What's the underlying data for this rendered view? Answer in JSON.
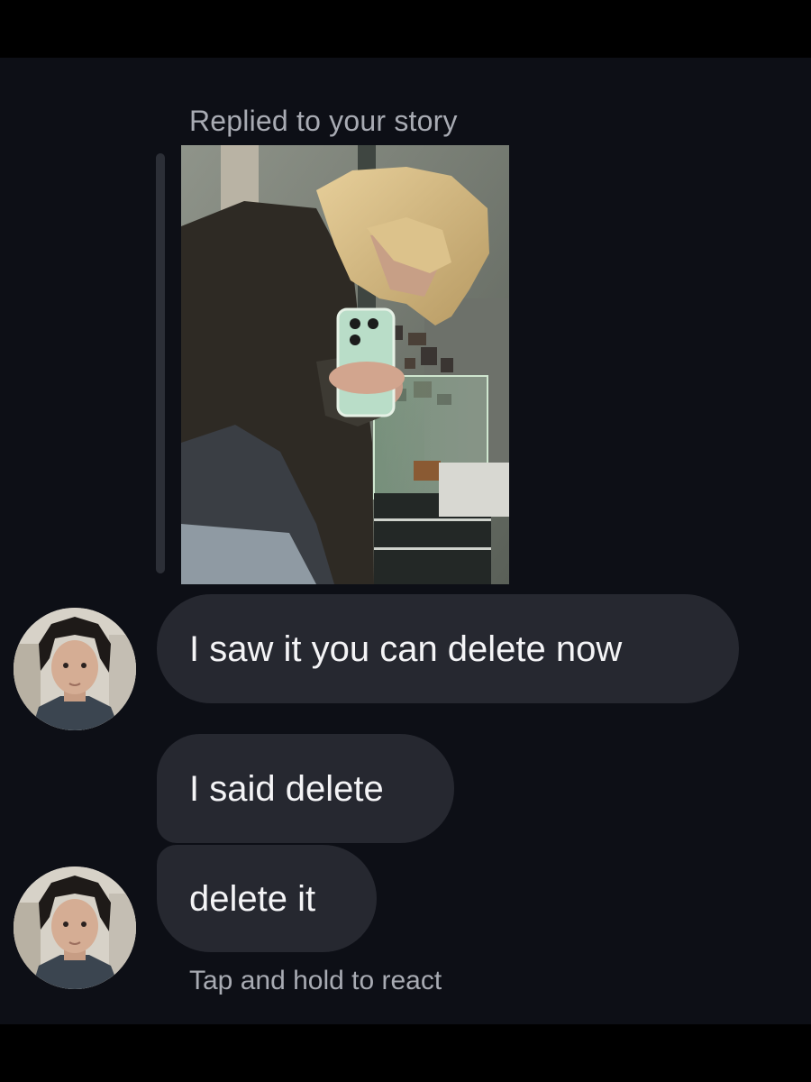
{
  "story_reply": {
    "label": "Replied to your story",
    "image_description": "story-photo"
  },
  "messages": [
    {
      "text": "I saw it you can delete now",
      "avatar": "sender-avatar"
    },
    {
      "text": "I said delete"
    },
    {
      "text": "delete it",
      "avatar": "sender-avatar"
    }
  ],
  "footer": {
    "hint": "Tap and hold to react"
  },
  "colors": {
    "background": "#0d0f16",
    "bubble": "#262830",
    "text": "#f4f4f6",
    "muted_text": "#a8abb3"
  }
}
